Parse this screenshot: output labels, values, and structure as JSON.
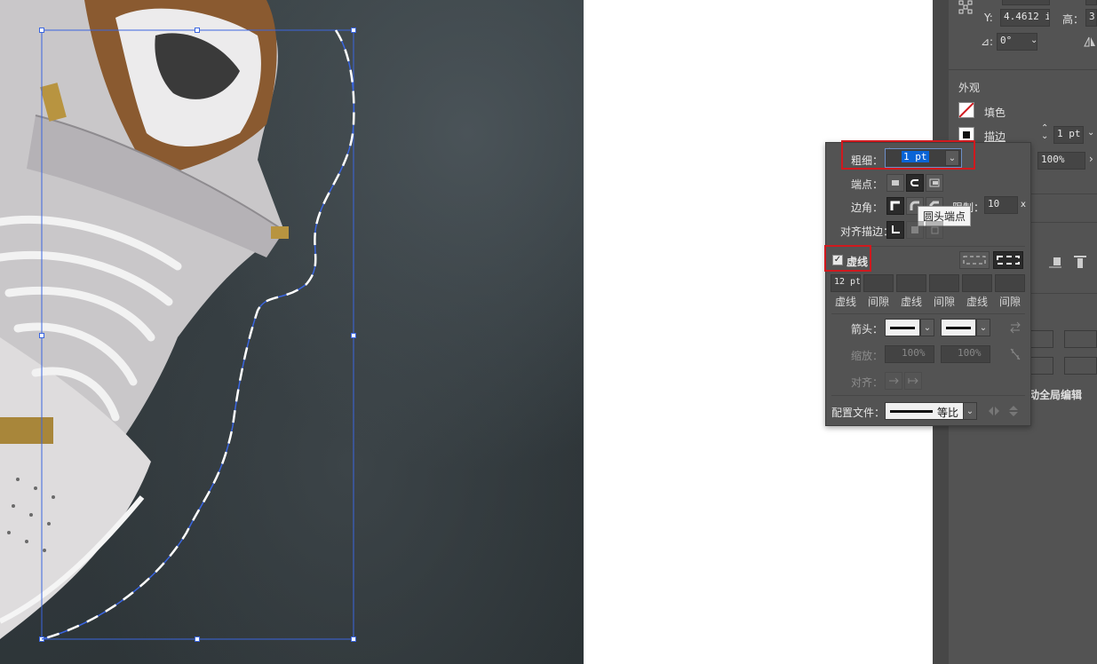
{
  "right_panel": {
    "transform": {
      "y_label": "Y:",
      "y_value": "4.4612 i",
      "height_label": "高：",
      "height_value": "3",
      "angle_symbol": "⊿:",
      "angle_value": "0°"
    },
    "appearance": {
      "section_title": "外观",
      "fill_label": "填色",
      "stroke_label": "描边",
      "stroke_value": "1 pt",
      "opacity_value": "100%"
    },
    "global_edit_label": "动全局编辑"
  },
  "stroke_panel": {
    "weight_label": "粗细：",
    "weight_value": "1 pt",
    "cap_label": "端点：",
    "corner_label": "边角：",
    "limit_label": "限制：",
    "limit_value": "10",
    "limit_unit": "x",
    "align_label": "对齐描边：",
    "tooltip": "圆头端点",
    "dashed_label": "虚线",
    "dashed_checked": true,
    "dash_values": [
      "12 pt",
      "",
      "",
      "",
      "",
      ""
    ],
    "dash_labels": [
      "虚线",
      "间隙",
      "虚线",
      "间隙",
      "虚线",
      "间隙"
    ],
    "arrow_label": "箭头：",
    "scale_label": "缩放：",
    "scale_values": [
      "100%",
      "100%"
    ],
    "align_arrow_label": "对齐：",
    "profile_label": "配置文件：",
    "profile_value": "等比"
  },
  "colors": {
    "panel_bg": "#535353",
    "highlight": "#d0191e",
    "selection": "#3b66e0",
    "field_selected": "#0a64d6"
  }
}
